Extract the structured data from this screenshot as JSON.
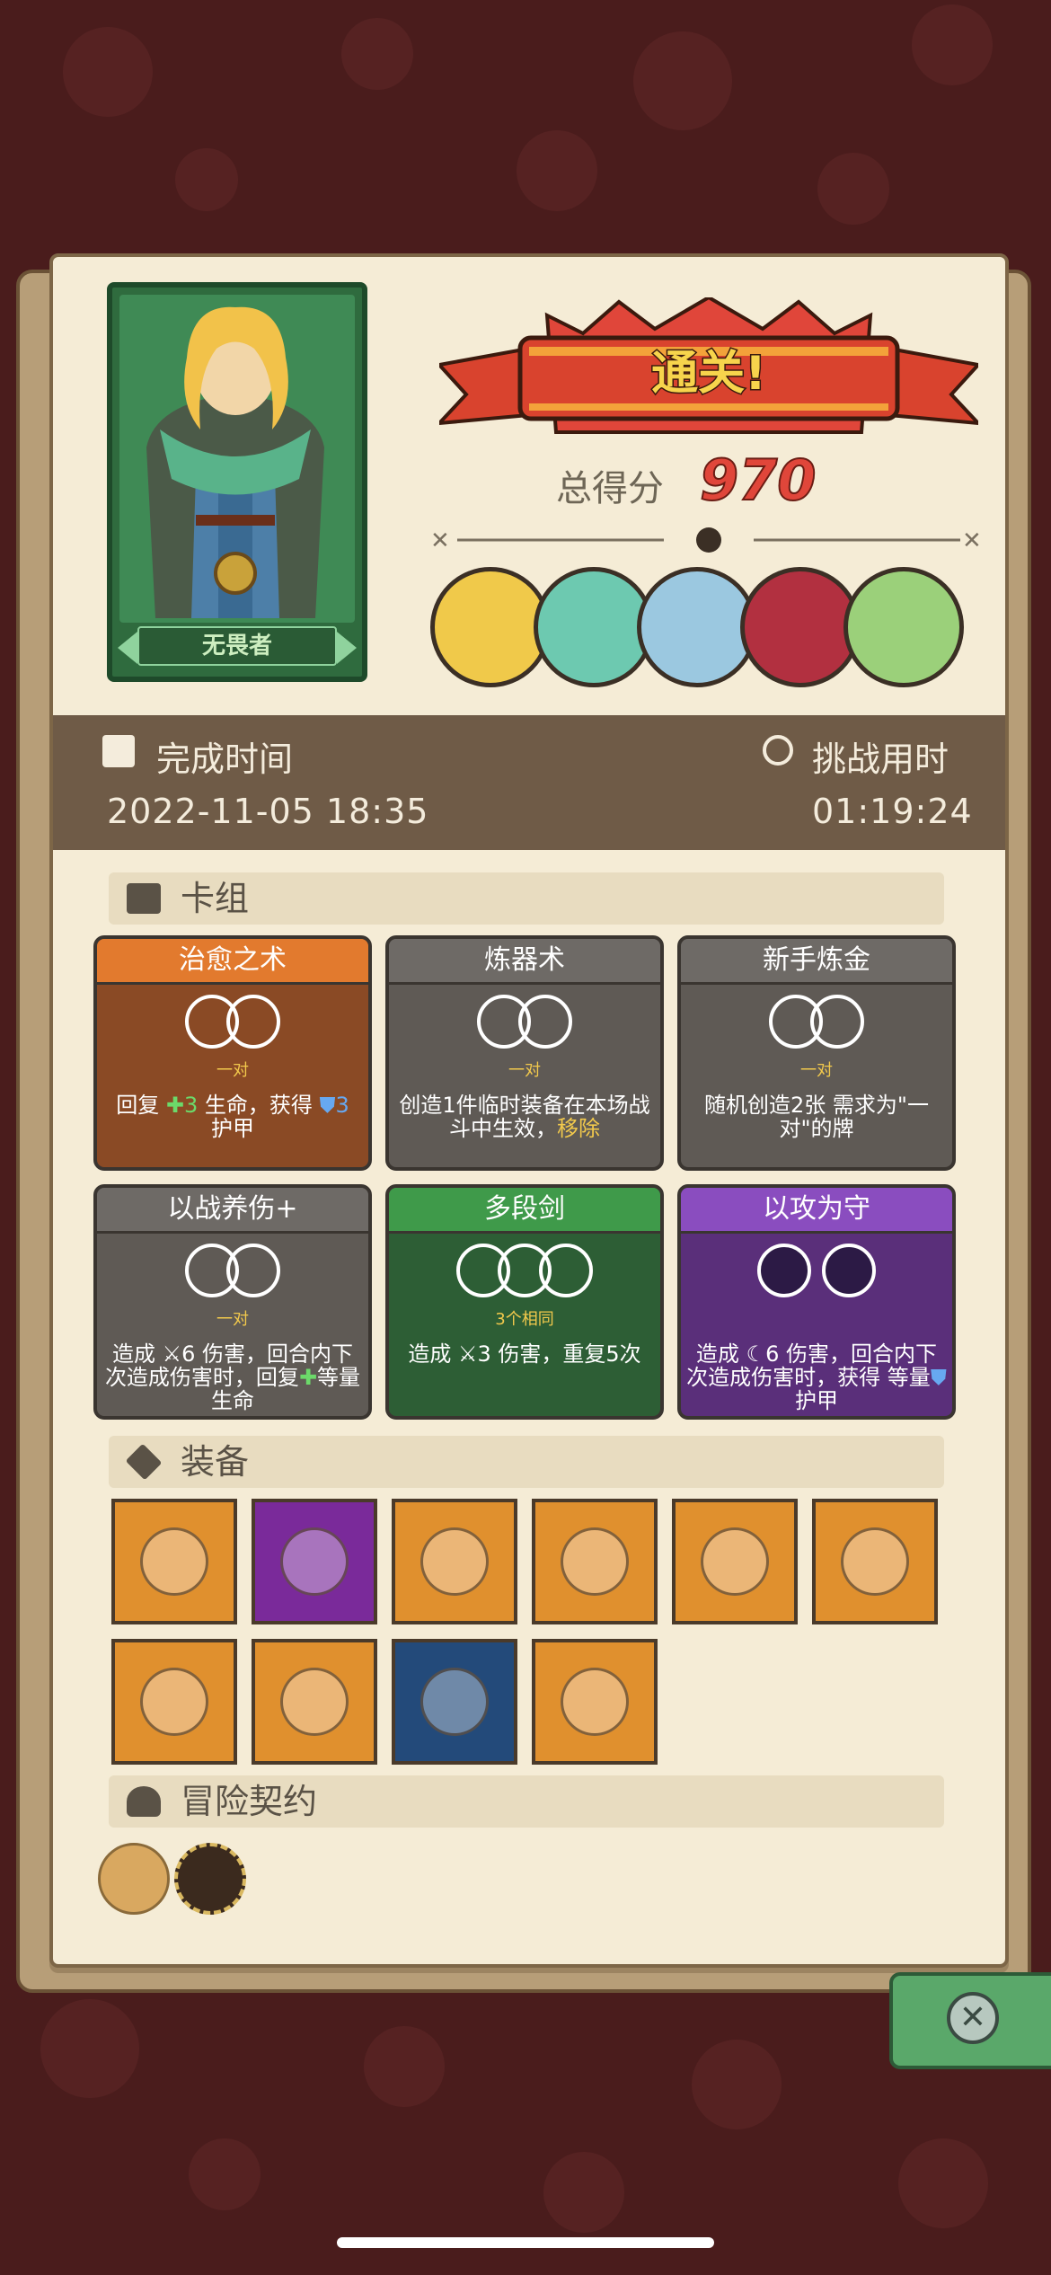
{
  "hero": {
    "name": "无畏者"
  },
  "result": {
    "title": "通关!",
    "score_label": "总得分",
    "score_value": "970"
  },
  "times": {
    "finish_label": "完成时间",
    "finish_value": "2022-11-05 18:35",
    "duration_label": "挑战用时",
    "duration_value": "01:19:24"
  },
  "deck": {
    "heading": "卡组",
    "cards": [
      {
        "title": "治愈之术",
        "tag": "一对",
        "desc_parts": [
          "回复 ",
          "✚3",
          " 生命，获得 ",
          "⛊3",
          " 护甲"
        ],
        "color": "#8a4a25",
        "title_color": "#e27a2e"
      },
      {
        "title": "炼器术",
        "tag": "一对",
        "desc_parts": [
          "创造1件临时装备在本场战斗中生效，",
          "移除"
        ],
        "color": "#5f5a55",
        "title_color": "#6e6a66"
      },
      {
        "title": "新手炼金",
        "tag": "一对",
        "desc_parts": [
          "随机创造2张 需求为\"一对\"的牌"
        ],
        "color": "#5f5a55",
        "title_color": "#6e6a66"
      },
      {
        "title": "以战养伤+",
        "tag": "一对",
        "desc_parts": [
          "造成 ",
          "⚔6",
          " 伤害，回合内下次造成伤害时，回复",
          "✚",
          "等量生命"
        ],
        "color": "#5f5a55",
        "title_color": "#6e6a66"
      },
      {
        "title": "多段剑",
        "tag": "3个相同",
        "desc_parts": [
          "造成 ",
          "⚔3",
          " 伤害，重复5次"
        ],
        "color": "#2d5e35",
        "title_color": "#3f9a4a"
      },
      {
        "title": "以攻为守",
        "tag": "",
        "desc_parts": [
          "造成 ",
          "☾6",
          " 伤害，回合内下次造成伤害时，获得 等量",
          "⛊",
          "护甲"
        ],
        "color": "#5a2f7a",
        "title_color": "#8a4dbf"
      }
    ]
  },
  "equipment": {
    "heading": "装备",
    "items": [
      {
        "icon": "ice-shield-icon",
        "bg": "#e0902e"
      },
      {
        "icon": "dark-dice-icon",
        "bg": "#7a2a9a"
      },
      {
        "icon": "money-bag-icon",
        "bg": "#e0902e"
      },
      {
        "icon": "heart-chest-icon",
        "bg": "#e0902e"
      },
      {
        "icon": "rainbow-dragon-icon",
        "bg": "#e0902e"
      },
      {
        "icon": "golden-crown-icon",
        "bg": "#e0902e"
      },
      {
        "icon": "blue-slime-icon",
        "bg": "#e0902e"
      },
      {
        "icon": "potion-jar-icon",
        "bg": "#e0902e"
      },
      {
        "icon": "compass-armor-icon",
        "bg": "#234a7a"
      },
      {
        "icon": "meat-leg-icon",
        "bg": "#e0902e"
      }
    ]
  },
  "contracts": {
    "heading": "冒险契约",
    "items": [
      {
        "icon": "scroll-icon"
      },
      {
        "icon": "golden-tag-icon"
      }
    ]
  },
  "colors": {
    "accent": "#e0463a",
    "paper": "#f5ecd6",
    "timebar": "#6f5b47"
  }
}
